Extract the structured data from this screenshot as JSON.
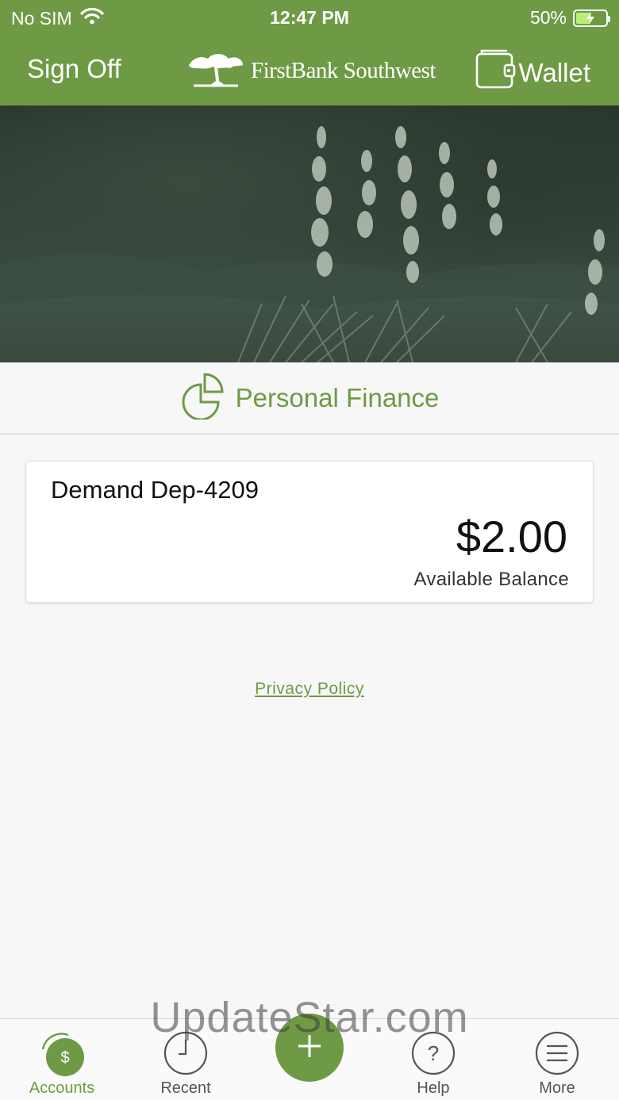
{
  "status": {
    "carrier": "No SIM",
    "time": "12:47 PM",
    "battery": "50%"
  },
  "header": {
    "sign_off": "Sign Off",
    "logo_text": "FirstBank Southwest",
    "wallet": "Wallet"
  },
  "personal_finance": {
    "label": "Personal Finance"
  },
  "account": {
    "name": "Demand Dep-4209",
    "amount": "$2.00",
    "sub_label": "Available Balance"
  },
  "privacy_link": "Privacy Policy",
  "tabs": [
    {
      "label": "Accounts",
      "icon": "accounts-dollar-icon",
      "active": true
    },
    {
      "label": "Recent",
      "icon": "clock-icon",
      "active": false
    },
    {
      "label": "",
      "icon": "plus-icon",
      "active": false
    },
    {
      "label": "Help",
      "icon": "question-icon",
      "active": false
    },
    {
      "label": "More",
      "icon": "menu-icon",
      "active": false
    }
  ],
  "watermark": "UpdateStar.com",
  "colors": {
    "brand_green": "#6f9a45",
    "hero_dark": "#2f3d33"
  }
}
